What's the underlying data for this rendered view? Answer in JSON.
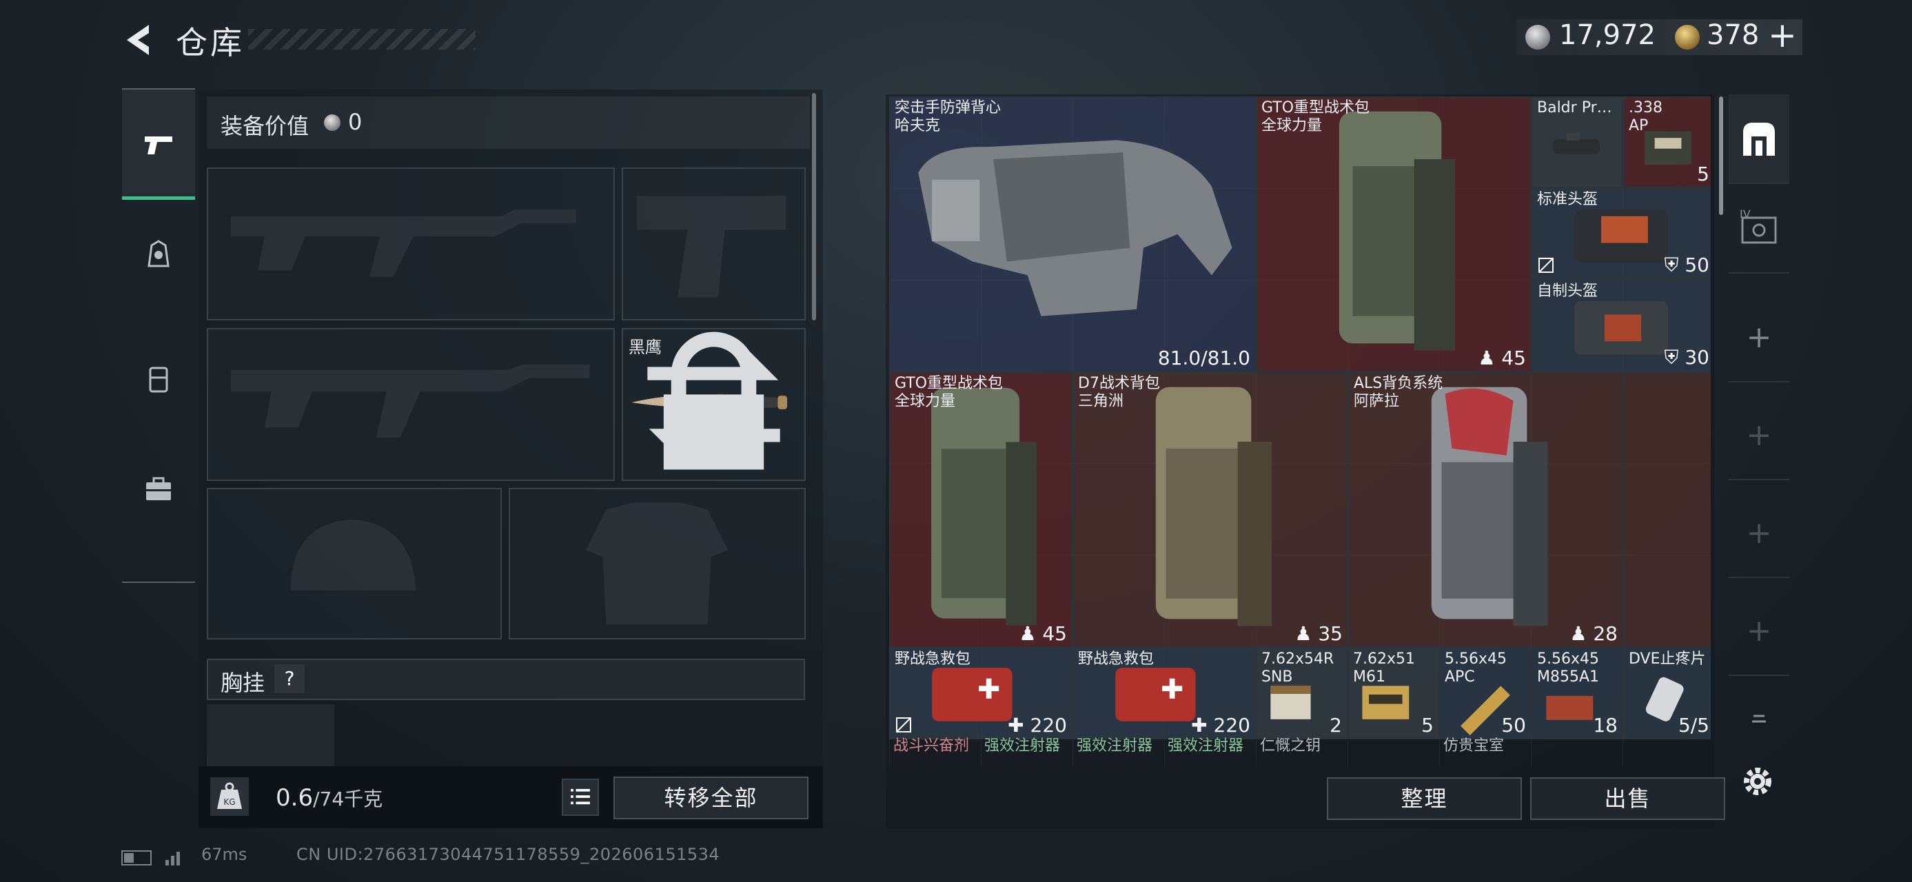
{
  "header": {
    "title": "仓库",
    "currency_silver": "17,972",
    "currency_gold": "378",
    "plus": "+"
  },
  "loadout": {
    "value_label": "装备价值",
    "value": "0",
    "melee_name": "黑鹰",
    "chest_label": "胸挂",
    "help": "?",
    "weight_current": "0.6",
    "weight_sep": "/",
    "weight_max": "74千克",
    "transfer_all": "转移全部"
  },
  "status": {
    "ping": "67ms",
    "uid": "CN UID:2766317304475117855‌9_202606151534"
  },
  "stash": {
    "items": [
      {
        "name": "突击手防弹背心\n哈夫克",
        "value": "81.0/81.0"
      },
      {
        "name": "GTO重型战术包\n全球力量",
        "value": "45"
      },
      {
        "name": "Baldr Pr…",
        "value": ""
      },
      {
        "name": ".338\nAP",
        "value": "5"
      },
      {
        "name": "标准头盔",
        "value": "50"
      },
      {
        "name": "自制头盔",
        "value": "30"
      },
      {
        "name": "GTO重型战术包\n全球力量",
        "value": "45"
      },
      {
        "name": "D7战术背包\n三角洲",
        "value": "35"
      },
      {
        "name": "ALS背负系统\n阿萨拉",
        "value": "28"
      },
      {
        "name": "野战急救包",
        "value": "220"
      },
      {
        "name": "野战急救包",
        "value": "220"
      },
      {
        "name": "7.62x54R\nSNB",
        "value": "2"
      },
      {
        "name": "7.62x51\nM61",
        "value": "5"
      },
      {
        "name": "5.56x45\nAPC",
        "value": "50"
      },
      {
        "name": "5.56x45\nM855A1",
        "value": "18"
      },
      {
        "name": "DVE止疼片",
        "value": "5/5"
      }
    ],
    "partial_labels": [
      "战斗兴奋剂",
      "强效注射器",
      "强效注射器",
      "强效注射器",
      "仁慨之钥",
      "仿贵宝室"
    ],
    "sort": "整理",
    "sell": "出售",
    "tab_iv": "IV"
  }
}
